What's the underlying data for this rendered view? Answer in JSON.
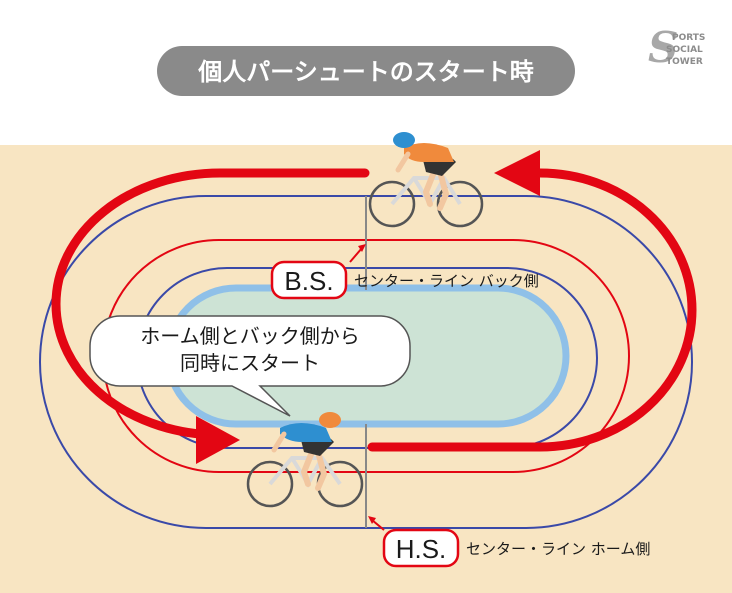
{
  "title": "個人パーシュートのスタート時",
  "back_station": {
    "abbr": "B.S.",
    "label": "センター・ライン バック側"
  },
  "home_station": {
    "abbr": "H.S.",
    "label": "センター・ライン ホーム側"
  },
  "callout": {
    "line1": "ホーム側とバック側から",
    "line2": "同時にスタート"
  },
  "logo": {
    "mark": "S",
    "line1": "PORTS",
    "line2": "SOCIAL",
    "line3": "TOWER"
  },
  "colors": {
    "title_bg": "#8a8a8a",
    "track_surface": "#f8e5c2",
    "infield": "#cde3d5",
    "infield_border": "#8fc0e8",
    "red_line": "#e30613",
    "blue_line": "#3a49a8",
    "center_line": "#888888",
    "rider_top_jersey": "#f08a3c",
    "rider_bottom_jersey": "#2e8fd0"
  },
  "icons": {
    "rider_top": "cyclist-icon",
    "rider_bottom": "cyclist-icon",
    "arrow": "arrow-icon"
  }
}
